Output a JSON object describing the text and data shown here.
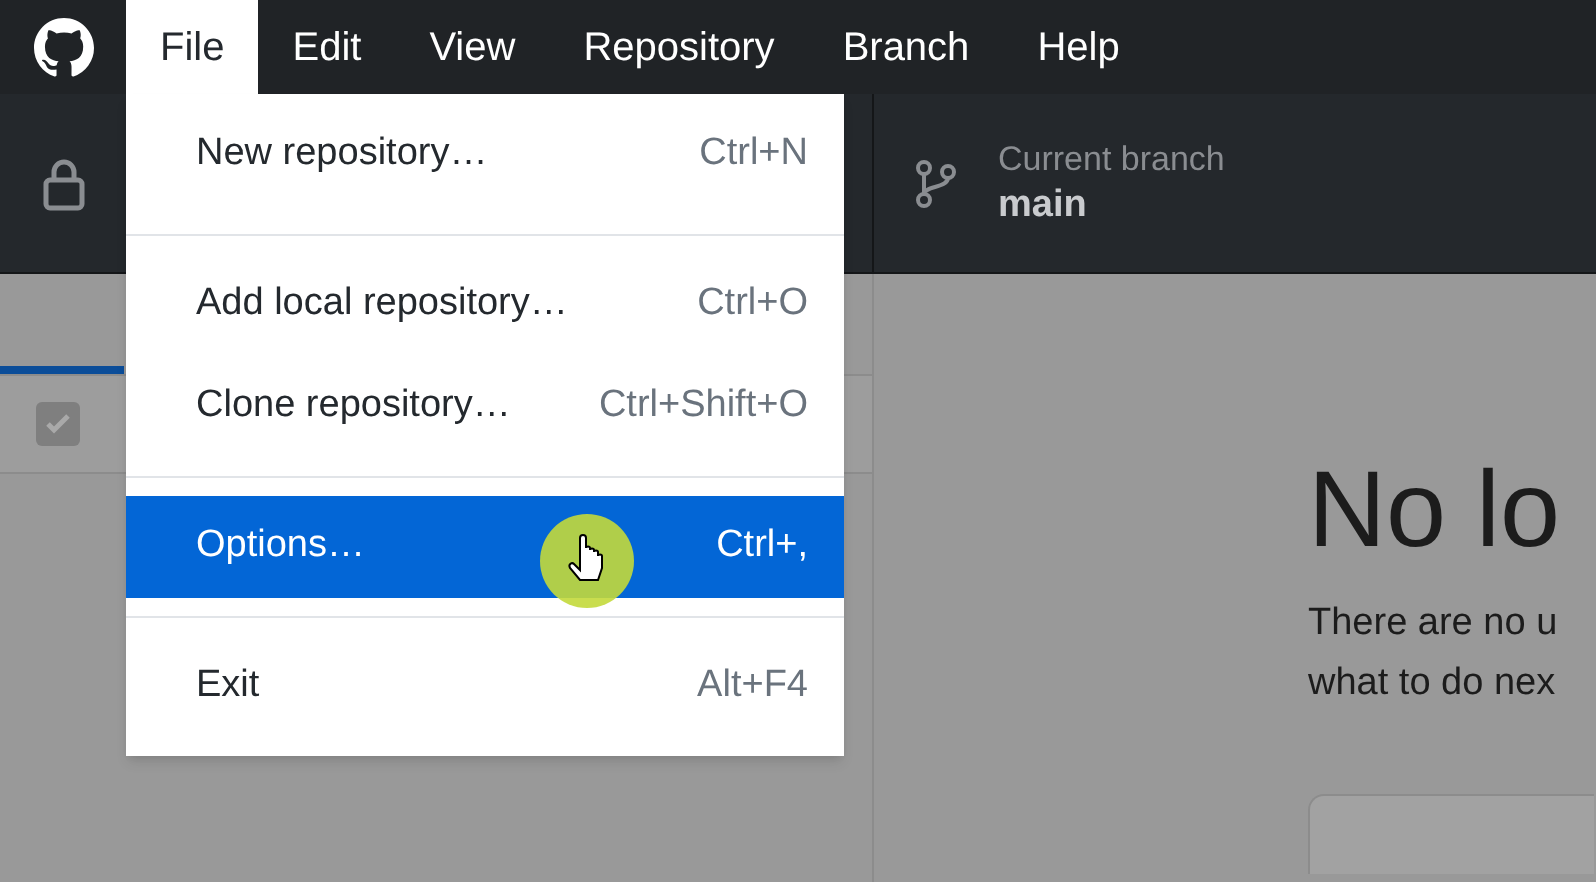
{
  "menubar": {
    "items": [
      {
        "label": "File",
        "selected": true
      },
      {
        "label": "Edit",
        "selected": false
      },
      {
        "label": "View",
        "selected": false
      },
      {
        "label": "Repository",
        "selected": false
      },
      {
        "label": "Branch",
        "selected": false
      },
      {
        "label": "Help",
        "selected": false
      }
    ]
  },
  "toolbar": {
    "branch_label": "Current branch",
    "branch_name": "main"
  },
  "file_menu": {
    "items": [
      {
        "kind": "item",
        "label": "New repository…",
        "shortcut": "Ctrl+N",
        "selected": false
      },
      {
        "kind": "separator"
      },
      {
        "kind": "item",
        "label": "Add local repository…",
        "shortcut": "Ctrl+O",
        "selected": false
      },
      {
        "kind": "item",
        "label": "Clone repository…",
        "shortcut": "Ctrl+Shift+O",
        "selected": false
      },
      {
        "kind": "separator"
      },
      {
        "kind": "item",
        "label": "Options…",
        "shortcut": "Ctrl+,",
        "selected": true
      },
      {
        "kind": "separator"
      },
      {
        "kind": "item",
        "label": "Exit",
        "shortcut": "Alt+F4",
        "selected": false
      }
    ]
  },
  "changes_list": {
    "select_all_checked": true
  },
  "empty_state": {
    "title": "No lo",
    "lines": [
      "There are no u",
      "what to do nex"
    ]
  }
}
